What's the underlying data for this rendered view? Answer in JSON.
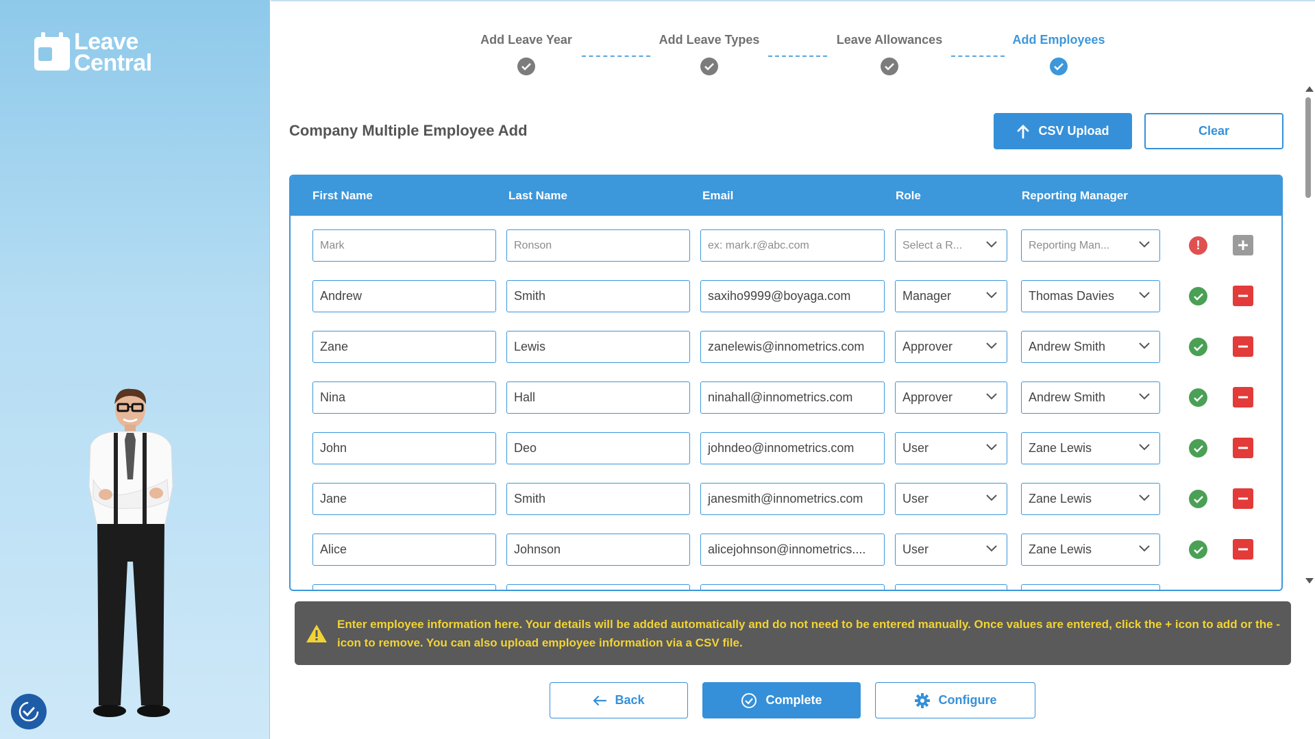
{
  "brand": {
    "name_line1": "Leave",
    "name_line2": "Central"
  },
  "stepper": {
    "steps": [
      {
        "label": "Add Leave Year",
        "active": false
      },
      {
        "label": "Add Leave Types",
        "active": false
      },
      {
        "label": "Leave Allowances",
        "active": false
      },
      {
        "label": "Add Employees",
        "active": true
      }
    ]
  },
  "page": {
    "title": "Company Multiple Employee Add"
  },
  "toolbar": {
    "csv_upload_label": "CSV Upload",
    "clear_label": "Clear"
  },
  "table": {
    "columns": [
      "First Name",
      "Last Name",
      "Email",
      "Role",
      "Reporting Manager"
    ],
    "new_row": {
      "first_name_placeholder": "Mark",
      "last_name_placeholder": "Ronson",
      "email_placeholder": "ex: mark.r@abc.com",
      "role_placeholder": "Select a R...",
      "manager_placeholder": "Reporting Man...",
      "status": "error"
    },
    "rows": [
      {
        "first_name": "Andrew",
        "last_name": "Smith",
        "email": "saxiho9999@boyaga.com",
        "role": "Manager",
        "manager": "Thomas Davies",
        "status": "valid"
      },
      {
        "first_name": "Zane",
        "last_name": "Lewis",
        "email": "zanelewis@innometrics.com",
        "role": "Approver",
        "manager": "Andrew Smith",
        "status": "valid"
      },
      {
        "first_name": "Nina",
        "last_name": "Hall",
        "email": "ninahall@innometrics.com",
        "role": "Approver",
        "manager": "Andrew Smith",
        "status": "valid"
      },
      {
        "first_name": "John",
        "last_name": "Deo",
        "email": "johndeo@innometrics.com",
        "role": "User",
        "manager": "Zane Lewis",
        "status": "valid"
      },
      {
        "first_name": "Jane",
        "last_name": "Smith",
        "email": "janesmith@innometrics.com",
        "role": "User",
        "manager": "Zane Lewis",
        "status": "valid"
      },
      {
        "first_name": "Alice",
        "last_name": "Johnson",
        "email": "alicejohnson@innometrics....",
        "role": "User",
        "manager": "Zane Lewis",
        "status": "valid"
      }
    ]
  },
  "info": {
    "message": "Enter employee information here. Your details will be added automatically and do not need to be entered manually. Once values are entered, click the + icon to add or the - icon to remove. You can also upload employee information via a CSV file."
  },
  "footer": {
    "back_label": "Back",
    "complete_label": "Complete",
    "configure_label": "Configure"
  },
  "colors": {
    "primary": "#3590d9",
    "success": "#4aa055",
    "danger": "#e33a3a",
    "warning_text": "#f2d335"
  }
}
